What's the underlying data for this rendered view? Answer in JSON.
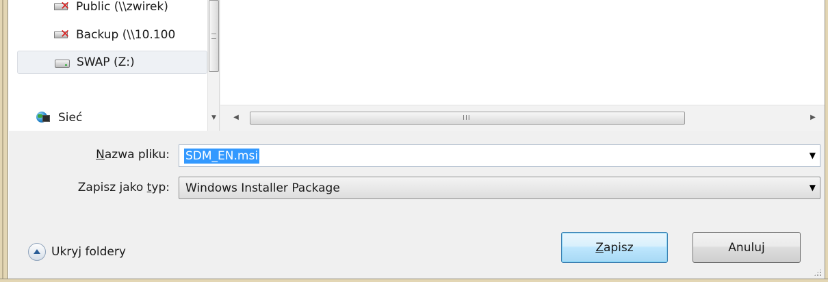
{
  "navigation": {
    "items": [
      {
        "label": "Public (\\\\zwirek)",
        "icon": "network-drive-disconnected-icon"
      },
      {
        "label": "Backup (\\\\10.100",
        "icon": "network-drive-disconnected-icon"
      },
      {
        "label": "SWAP (Z:)",
        "icon": "drive-icon",
        "selected": true
      },
      {
        "label": "Sieć",
        "icon": "network-globe-icon"
      }
    ]
  },
  "form": {
    "filename_label_accel": "N",
    "filename_label_rest": "azwa pliku:",
    "filename_value": "SDM_EN.msi",
    "filetype_label_pre": "Zapisz jako ",
    "filetype_label_accel": "t",
    "filetype_label_post": "yp:",
    "filetype_value": "Windows Installer Package"
  },
  "footer": {
    "hide_folders_label": "Ukryj foldery",
    "save_accel": "Z",
    "save_rest": "apisz",
    "cancel_label": "Anuluj"
  },
  "scrollbar": {
    "grip": "III"
  }
}
